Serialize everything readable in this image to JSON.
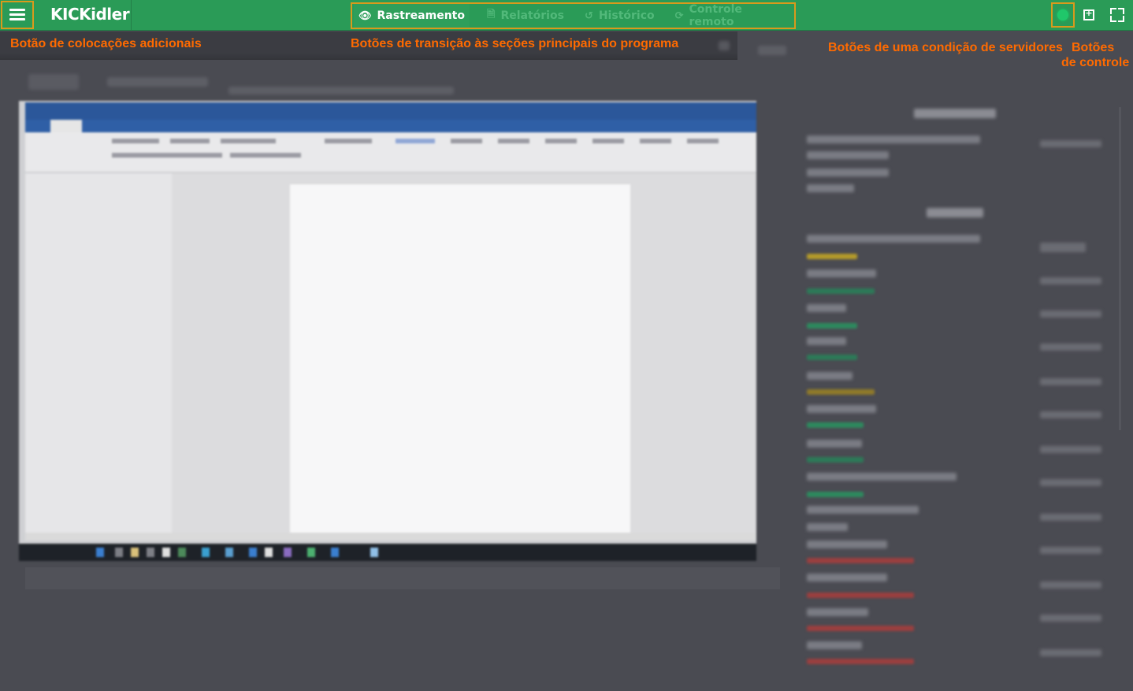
{
  "app": {
    "logo": "KICKidler",
    "menu_icon": "hamburger-icon"
  },
  "nav": {
    "items": [
      {
        "label": "Rastreamento",
        "icon": "eye-icon",
        "active": true
      },
      {
        "label": "Relatórios",
        "icon": "report-icon",
        "active": false
      },
      {
        "label": "Histórico",
        "icon": "history-icon",
        "active": false
      },
      {
        "label": "Controle remoto",
        "icon": "remote-icon",
        "active": false
      }
    ]
  },
  "controls": {
    "server_status_icon": "server-status-icon",
    "add_icon": "add-window-icon",
    "fullscreen_icon": "fullscreen-icon"
  },
  "annotations": {
    "menu": "Botão de colocações adicionais",
    "nav": "Botões de transição às seções principais do programa",
    "servers": "Botões de uma condição de servidores",
    "controls_line1": "Botões",
    "controls_line2": "de controle"
  },
  "colors": {
    "topbar": "#2a9b57",
    "annotation": "#ff6a00",
    "highlight_border": "#d99a1c",
    "server_status": "#20c76a",
    "background": "#4a4b52"
  }
}
